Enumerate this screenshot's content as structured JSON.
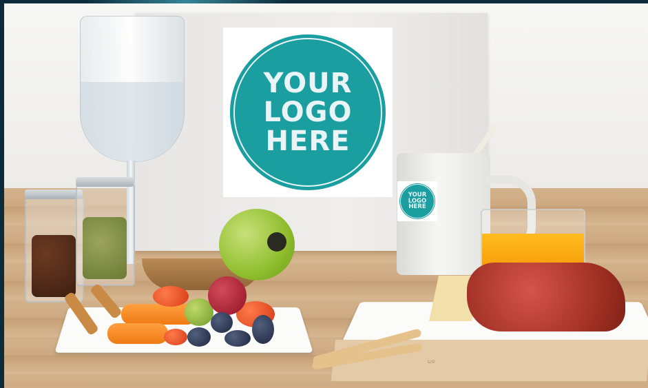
{
  "image": {
    "big_logo": {
      "lines": [
        "YOUR",
        "LOGO",
        "HERE"
      ],
      "color": "#1a9ea0"
    },
    "small_logo": {
      "lines": [
        "YOUR",
        "LOGO",
        "HERE"
      ],
      "color": "#1a9ea0"
    },
    "napkin_text": "ಟ೪"
  }
}
